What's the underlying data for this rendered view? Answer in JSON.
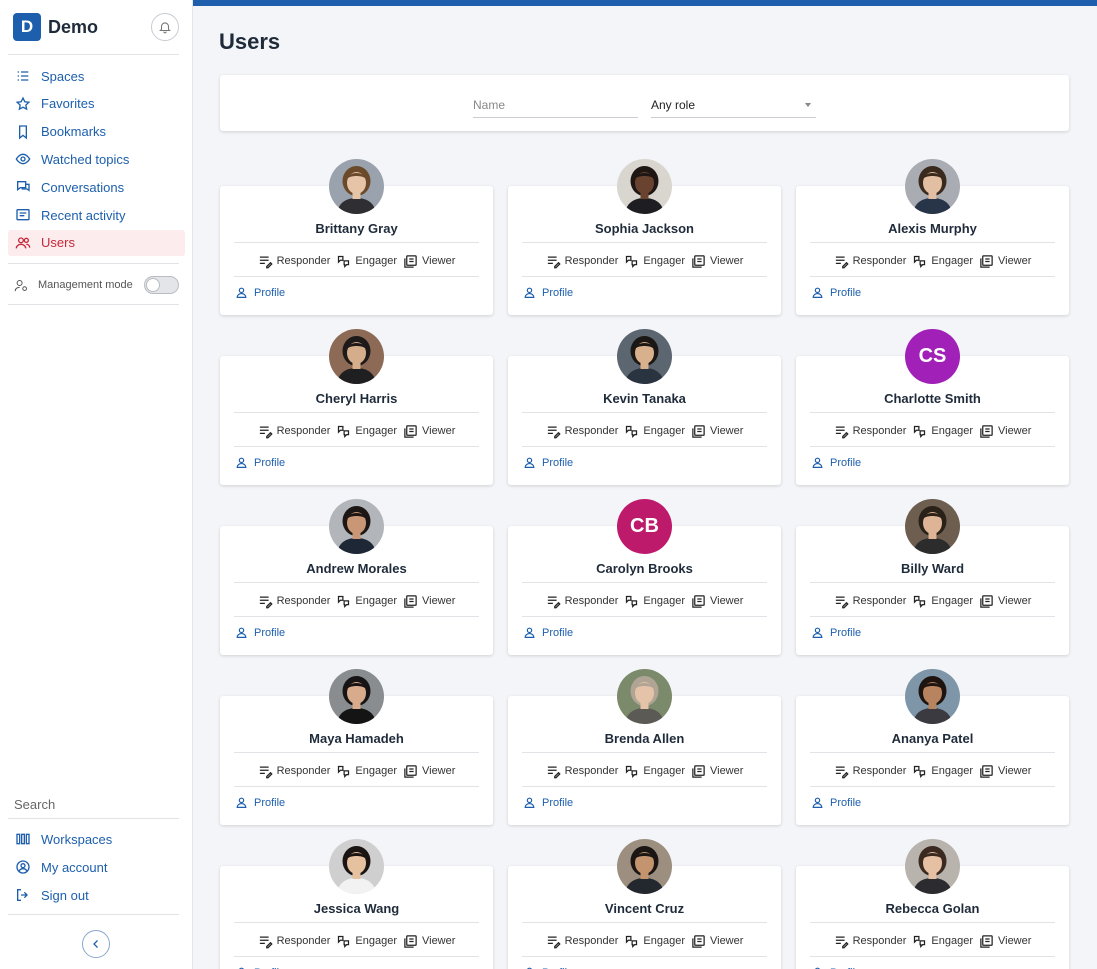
{
  "app": {
    "logo_letter": "D",
    "name": "Demo"
  },
  "sidebar": {
    "items": [
      {
        "key": "spaces",
        "label": "Spaces",
        "icon": "list-icon"
      },
      {
        "key": "favorites",
        "label": "Favorites",
        "icon": "star-icon"
      },
      {
        "key": "bookmarks",
        "label": "Bookmarks",
        "icon": "bookmark-icon"
      },
      {
        "key": "watched",
        "label": "Watched topics",
        "icon": "eye-icon"
      },
      {
        "key": "conversations",
        "label": "Conversations",
        "icon": "chat-icon"
      },
      {
        "key": "recent",
        "label": "Recent activity",
        "icon": "activity-icon"
      },
      {
        "key": "users",
        "label": "Users",
        "icon": "users-icon",
        "active": true
      }
    ],
    "management_mode": {
      "label": "Management mode",
      "enabled": false
    },
    "search_label": "Search",
    "bottom_items": [
      {
        "key": "workspaces",
        "label": "Workspaces",
        "icon": "workspaces-icon"
      },
      {
        "key": "account",
        "label": "My account",
        "icon": "account-icon"
      },
      {
        "key": "signout",
        "label": "Sign out",
        "icon": "sign-out-icon"
      }
    ]
  },
  "page": {
    "title": "Users"
  },
  "filters": {
    "name_placeholder": "Name",
    "role_value": "Any role"
  },
  "roles": [
    "Responder",
    "Engager",
    "Viewer"
  ],
  "profile_label": "Profile",
  "colors": {
    "accent": "#1d5fad",
    "active": "#c62839"
  },
  "users": [
    {
      "name": "Brittany Gray",
      "avatar": "photo",
      "skin": "#e6c4a7",
      "hair": "#6b4a2b",
      "bg": "#9aa3ad",
      "shirt": "#2e2e33"
    },
    {
      "name": "Sophia Jackson",
      "avatar": "photo",
      "skin": "#6a4330",
      "hair": "#1e1713",
      "bg": "#d9d5cf",
      "shirt": "#1e1e22"
    },
    {
      "name": "Alexis Murphy",
      "avatar": "photo",
      "skin": "#e2bfa2",
      "hair": "#3a2a1e",
      "bg": "#a9adb3",
      "shirt": "#283448"
    },
    {
      "name": "Cheryl Harris",
      "avatar": "photo",
      "skin": "#d6ad8b",
      "hair": "#1d1a19",
      "bg": "#8c6a55",
      "shirt": "#1f1f22"
    },
    {
      "name": "Kevin Tanaka",
      "avatar": "photo",
      "skin": "#d9b08e",
      "hair": "#1b1714",
      "bg": "#5b6670",
      "shirt": "#2a3340"
    },
    {
      "name": "Charlotte Smith",
      "avatar": "initials",
      "initials": "CS",
      "color": "#a020b8"
    },
    {
      "name": "Andrew Morales",
      "avatar": "photo",
      "skin": "#c99776",
      "hair": "#1c1714",
      "bg": "#b2b6ba",
      "shirt": "#1e2736"
    },
    {
      "name": "Carolyn Brooks",
      "avatar": "initials",
      "initials": "CB",
      "color": "#be1a6c"
    },
    {
      "name": "Billy Ward",
      "avatar": "photo",
      "skin": "#ddb596",
      "hair": "#2a2118",
      "bg": "#6e5e50",
      "shirt": "#2c2c2c"
    },
    {
      "name": "Maya Hamadeh",
      "avatar": "photo",
      "skin": "#d7ab8c",
      "hair": "#161414",
      "bg": "#8a8d90",
      "shirt": "#141414"
    },
    {
      "name": "Brenda Allen",
      "avatar": "photo",
      "skin": "#e5c3a8",
      "hair": "#b0a595",
      "bg": "#7b8a6a",
      "shirt": "#5c5a55"
    },
    {
      "name": "Ananya Patel",
      "avatar": "photo",
      "skin": "#b88460",
      "hair": "#1e1511",
      "bg": "#7e96a8",
      "shirt": "#3a3a40"
    },
    {
      "name": "Jessica Wang",
      "avatar": "photo",
      "skin": "#e6c1a0",
      "hair": "#1a1513",
      "bg": "#cfcfcf",
      "shirt": "#f2f2f2"
    },
    {
      "name": "Vincent Cruz",
      "avatar": "photo",
      "skin": "#c4946e",
      "hair": "#1b1613",
      "bg": "#9c8f80",
      "shirt": "#23272e"
    },
    {
      "name": "Rebecca Golan",
      "avatar": "photo",
      "skin": "#e5c0a3",
      "hair": "#3b2a20",
      "bg": "#b8b3ad",
      "shirt": "#2b2b30"
    }
  ]
}
